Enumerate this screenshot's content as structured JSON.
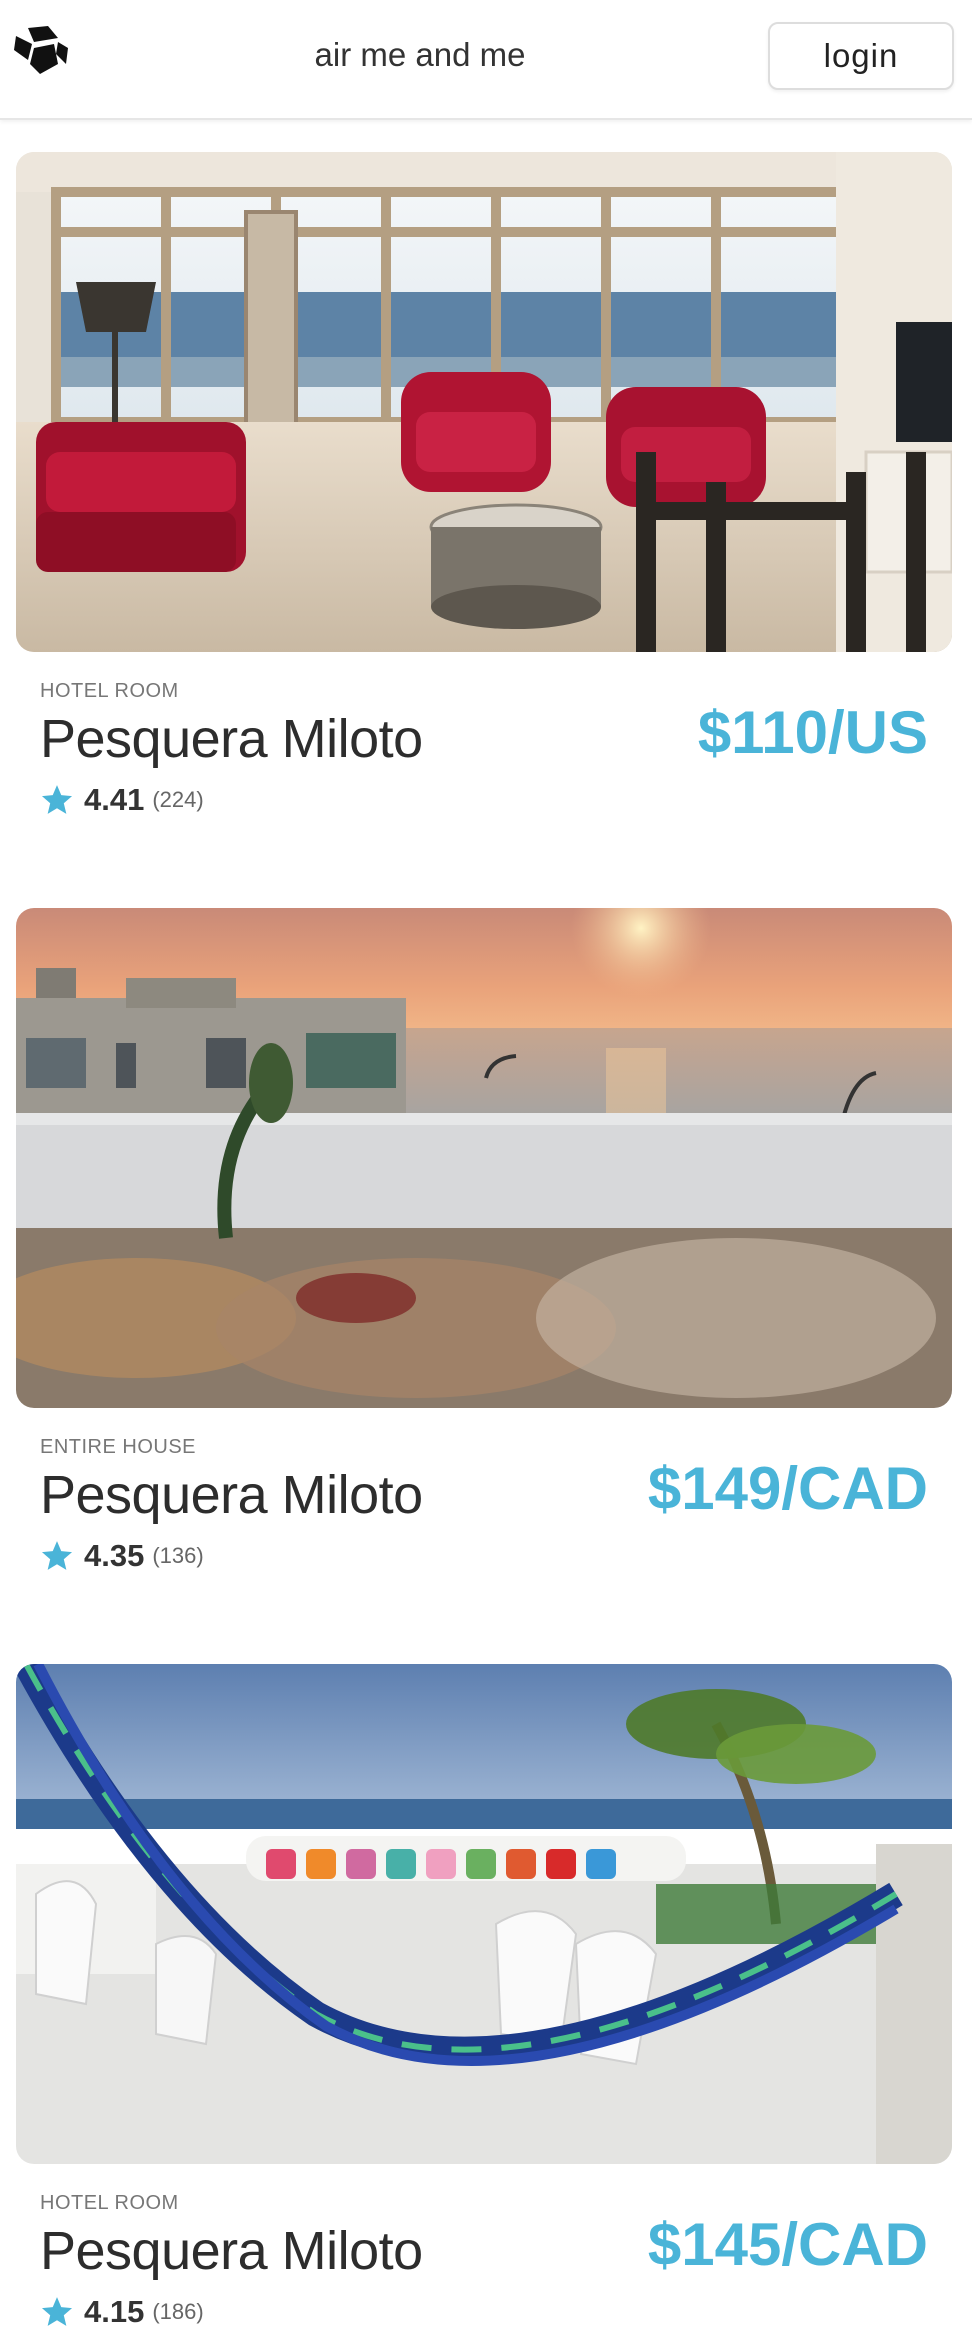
{
  "header": {
    "logo_icon": "cube-logo-icon",
    "brand": "air me and me",
    "login_label": "login"
  },
  "accent_color": "#4ab4d8",
  "listings": [
    {
      "type": "HOTEL ROOM",
      "title": "Pesquera Miloto",
      "rating": "4.41",
      "reviews": "(224)",
      "price": "$110/US",
      "photo": "living-room-ocean-view-photo"
    },
    {
      "type": "ENTIRE HOUSE",
      "title": "Pesquera Miloto",
      "rating": "4.35",
      "reviews": "(136)",
      "price": "$149/CAD",
      "photo": "sunset-terrace-photo"
    },
    {
      "type": "HOTEL ROOM",
      "title": "Pesquera Miloto",
      "rating": "4.15",
      "reviews": "(186)",
      "price": "$145/CAD",
      "photo": "rooftop-hammock-photo"
    }
  ]
}
